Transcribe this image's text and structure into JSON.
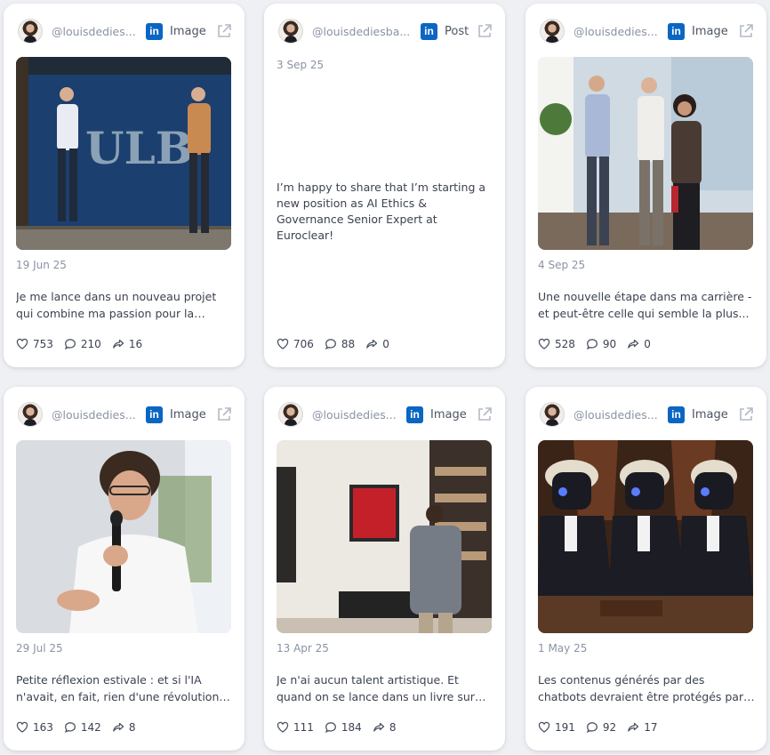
{
  "posts": [
    {
      "handle": "@louisdedies...",
      "kind": "Image",
      "date": "19 Jun 25",
      "text": "Je me lance dans un nouveau projet qui combine ma passion pour la recherche,...",
      "likes": "753",
      "comments": "210",
      "shares": "16",
      "photo": "ulb-storefront"
    },
    {
      "handle": "@louisdediesba...",
      "kind": "Post",
      "date": "3 Sep 25",
      "text": "I’m happy to share that I’m starting a new position as AI Ethics & Governance Senior Expert at Euroclear!",
      "likes": "706",
      "comments": "88",
      "shares": "0"
    },
    {
      "handle": "@louisdedies...",
      "kind": "Image",
      "date": "4 Sep 25",
      "text": "Une nouvelle étape dans ma carrière - et peut-être celle qui semble la plus...",
      "likes": "528",
      "comments": "90",
      "shares": "0",
      "photo": "office-trio"
    },
    {
      "handle": "@louisdedies...",
      "kind": "Image",
      "date": "29 Jul 25",
      "text": "Petite réflexion estivale : et si l'IA n'avait, en fait, rien d'une révolution ? 🤔  Oui, je...",
      "likes": "163",
      "comments": "142",
      "shares": "8",
      "photo": "speaker-mic"
    },
    {
      "handle": "@louisdedies...",
      "kind": "Image",
      "date": "13 Apr 25",
      "text": "Je n'ai aucun talent artistique. Et quand on se lance dans un livre sur l'impact de...",
      "likes": "111",
      "comments": "184",
      "shares": "8",
      "photo": "living-room"
    },
    {
      "handle": "@louisdedies...",
      "kind": "Image",
      "date": "1 May 25",
      "text": "Les contenus générés par des chatbots devraient être protégés par la Premier...",
      "likes": "191",
      "comments": "92",
      "shares": "17",
      "photo": "robot-judges"
    }
  ],
  "colors": {
    "linkedin": "#0a66c2",
    "background": "#eef0f4",
    "card": "#ffffff",
    "muted": "#8a93a3"
  }
}
